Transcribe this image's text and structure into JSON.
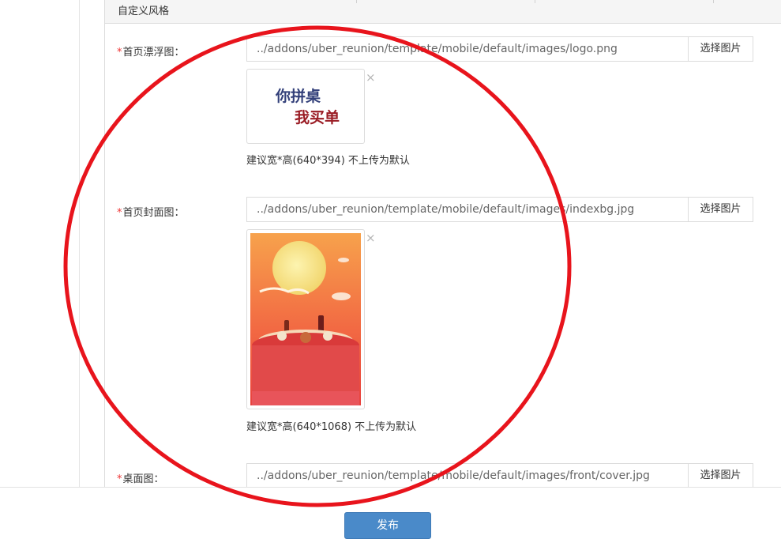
{
  "panel": {
    "title": "自定义风格"
  },
  "fields": [
    {
      "required_mark": "*",
      "label": "首页漂浮图：",
      "value": "../addons/uber_reunion/template/mobile/default/images/logo.png",
      "button": "选择图片",
      "hint": "建议宽*高(640*394) 不上传为默认",
      "preview_text": [
        "你拼桌",
        "我买单"
      ]
    },
    {
      "required_mark": "*",
      "label": "首页封面图：",
      "value": "../addons/uber_reunion/template/mobile/default/images/indexbg.jpg",
      "button": "选择图片",
      "hint": "建议宽*高(640*1068) 不上传为默认"
    },
    {
      "required_mark": "*",
      "label": "桌面图：",
      "value": "../addons/uber_reunion/template/mobile/default/images/front/cover.jpg",
      "button": "选择图片"
    }
  ],
  "remove_glyph": "×",
  "footer": {
    "publish_label": "发布"
  },
  "colors": {
    "accent": "#4a8ac9",
    "required": "#e33333",
    "annotation": "#e8141c"
  }
}
